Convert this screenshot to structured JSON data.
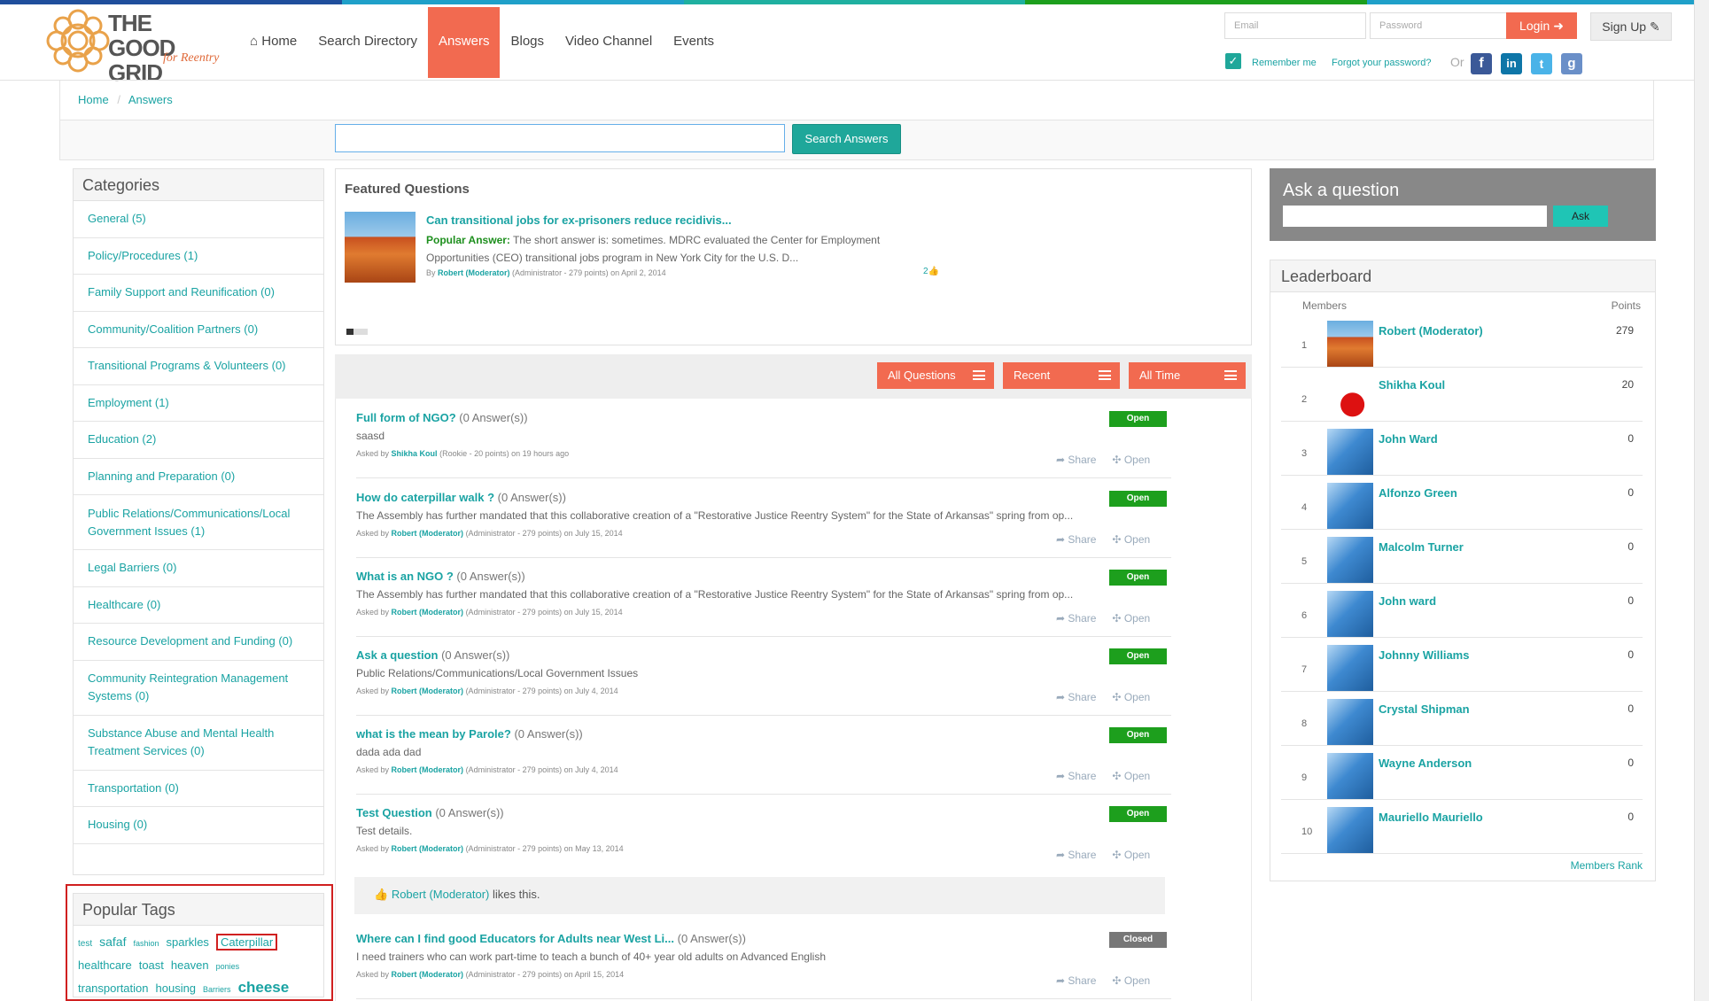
{
  "colors": {
    "accent": "#f26a50",
    "teal": "#1aa3a3",
    "open": "#1d9f1d",
    "closed": "#777777",
    "topbar": [
      "#1f4e9c",
      "#1fa0c9",
      "#1fb0a0",
      "#1d9f1d",
      "#1fa0c9"
    ]
  },
  "header": {
    "logo_main": "THE GOOD GRID",
    "logo_sub": "for Reentry",
    "nav": [
      {
        "label": "Home",
        "icon": "home-icon"
      },
      {
        "label": "Search Directory"
      },
      {
        "label": "Answers",
        "active": true
      },
      {
        "label": "Blogs"
      },
      {
        "label": "Video Channel"
      },
      {
        "label": "Events"
      }
    ],
    "email_placeholder": "Email",
    "password_placeholder": "Password",
    "login": "Login",
    "signup": "Sign Up",
    "remember": "Remember me",
    "forgot": "Forgot your password?",
    "or": "Or",
    "social": [
      "facebook-icon",
      "linkedin-icon",
      "twitter-icon",
      "google-icon"
    ]
  },
  "breadcrumb": {
    "home": "Home",
    "sep": "/",
    "current": "Answers"
  },
  "search": {
    "button": "Search Answers",
    "value": ""
  },
  "categories": {
    "title": "Categories",
    "items": [
      "General (5)",
      "Policy/Procedures (1)",
      "Family Support and Reunification (0)",
      "Community/Coalition Partners (0)",
      "Transitional Programs & Volunteers (0)",
      "Employment (1)",
      "Education (2)",
      "Planning and Preparation (0)",
      "Public Relations/Communications/Local Government Issues (1)",
      "Legal Barriers (0)",
      "Healthcare (0)",
      "Resource Development and Funding (0)",
      "Community Reintegration Management Systems (0)",
      "Substance Abuse and Mental Health Treatment Services (0)",
      "Transportation (0)",
      "Housing (0)"
    ]
  },
  "featured": {
    "title": "Featured Questions",
    "q_title": "Can transitional jobs for ex-prisoners reduce recidivis...",
    "popular_label": "Popular Answer:",
    "answer": "The short answer is: sometimes. MDRC evaluated the Center for Employment Opportunities (CEO) transitional jobs program in New York City for the U.S. D...",
    "by": "By",
    "author": "Robert (Moderator)",
    "meta": "(Administrator - 279 points)  on April 2, 2014",
    "likes": "2"
  },
  "filters": {
    "all": "All Questions",
    "recent": "Recent",
    "time": "All Time"
  },
  "questions": [
    {
      "title": "Full form of NGO?",
      "count": "(0 Answer(s))",
      "desc": "saasd",
      "asked": "Asked by",
      "author": "Shikha Koul",
      "meta": "(Rookie - 20 points) on 19 hours ago",
      "status": "Open"
    },
    {
      "title": "How do caterpillar walk ?",
      "count": "(0 Answer(s))",
      "desc": "The Assembly has further mandated that this collaborative creation of a \"Restorative Justice Reentry System\" for the State of Arkansas\" spring from op...",
      "asked": "Asked by",
      "author": "Robert (Moderator)",
      "meta": "(Administrator - 279 points) on July 15, 2014",
      "status": "Open"
    },
    {
      "title": "What is an NGO ?",
      "count": "(0 Answer(s))",
      "desc": "The Assembly has further mandated that this collaborative creation of a \"Restorative Justice Reentry System\" for the State of Arkansas\" spring from op...",
      "asked": "Asked by",
      "author": "Robert (Moderator)",
      "meta": "(Administrator - 279 points) on July 15, 2014",
      "status": "Open"
    },
    {
      "title": "Ask a question",
      "count": "(0 Answer(s))",
      "desc": "Public Relations/Communications/Local Government Issues",
      "asked": "Asked by",
      "author": "Robert (Moderator)",
      "meta": "(Administrator - 279 points) on July 4, 2014",
      "status": "Open"
    },
    {
      "title": "what is the mean by Parole?",
      "count": "(0 Answer(s))",
      "desc": "dada ada dad",
      "asked": "Asked by",
      "author": "Robert (Moderator)",
      "meta": "(Administrator - 279 points) on July 4, 2014",
      "status": "Open"
    },
    {
      "title": "Test Question",
      "count": "(0 Answer(s))",
      "desc": "Test details.",
      "asked": "Asked by",
      "author": "Robert (Moderator)",
      "meta": "(Administrator - 279 points) on May 13, 2014",
      "status": "Open"
    },
    {
      "title": "Where can I find good Educators for Adults near West Li...",
      "count": "(0 Answer(s))",
      "desc": "I need trainers who can work part-time to teach a bunch of 40+ year old adults on Advanced English",
      "asked": "Asked by",
      "author": "Robert (Moderator)",
      "meta": "(Administrator - 279 points) on April 15, 2014",
      "status": "Closed"
    }
  ],
  "share": "Share",
  "open": "Open",
  "likes_row": {
    "who": "Robert (Moderator)",
    "text": "likes this."
  },
  "ask": {
    "title": "Ask a question",
    "button": "Ask"
  },
  "leaderboard": {
    "title": "Leaderboard",
    "members": "Members",
    "points": "Points",
    "rank_link": "Members Rank",
    "rows": [
      {
        "n": "1",
        "name": "Robert (Moderator)",
        "pts": "279"
      },
      {
        "n": "2",
        "name": "Shikha Koul",
        "pts": "20"
      },
      {
        "n": "3",
        "name": "John Ward",
        "pts": "0"
      },
      {
        "n": "4",
        "name": "Alfonzo Green",
        "pts": "0"
      },
      {
        "n": "5",
        "name": "Malcolm Turner",
        "pts": "0"
      },
      {
        "n": "6",
        "name": "John ward",
        "pts": "0"
      },
      {
        "n": "7",
        "name": "Johnny Williams",
        "pts": "0"
      },
      {
        "n": "8",
        "name": "Crystal Shipman",
        "pts": "0"
      },
      {
        "n": "9",
        "name": "Wayne Anderson",
        "pts": "0"
      },
      {
        "n": "10",
        "name": "Mauriello Mauriello",
        "pts": "0"
      }
    ]
  },
  "tags": {
    "title": "Popular Tags",
    "items": [
      "test",
      "safaf",
      "fashion",
      "sparkles",
      "Caterpillar",
      "healthcare",
      "toast",
      "heaven",
      "ponies",
      "transportation",
      "housing",
      "Barriers",
      "cheese"
    ]
  }
}
